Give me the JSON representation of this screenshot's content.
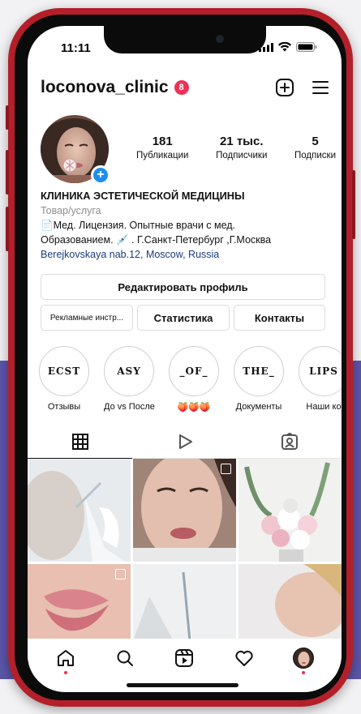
{
  "status_bar": {
    "time": "11:11"
  },
  "header": {
    "username": "loconova_clinic",
    "notification_count": "8"
  },
  "stats": [
    {
      "value": "181",
      "label": "Публикации"
    },
    {
      "value": "21 тыс.",
      "label": "Подписчики"
    },
    {
      "value": "5",
      "label": "Подписки"
    }
  ],
  "bio": {
    "title": "КЛИНИКА ЭСТЕТИЧЕСКОЙ МЕДИЦИНЫ",
    "category": "Товар/услуга",
    "line1": "📄Мед. Лицензия. Опытные врачи с мед.",
    "line2": "Образованием. 💉 . Г.Санкт-Петербург ,Г.Москва",
    "address": "Berejkovskaya nab.12, Moscow, Russia"
  },
  "buttons": {
    "edit_profile": "Редактировать профиль",
    "ads_tools": "Рекламные инстр...",
    "statistics": "Статистика",
    "contacts": "Контакты"
  },
  "highlights": [
    {
      "cover": "ECST",
      "label": "Отзывы"
    },
    {
      "cover": "ASY",
      "label": "До vs После"
    },
    {
      "cover": "_OF_",
      "label": "🍑🍑🍑"
    },
    {
      "cover": "THE_",
      "label": "Документы"
    },
    {
      "cover": "LIPS",
      "label": "Наши ко"
    }
  ],
  "tabs": [
    {
      "icon": "grid-icon",
      "active": true
    },
    {
      "icon": "reels-play-icon",
      "active": false
    },
    {
      "icon": "tagged-person-icon",
      "active": false
    }
  ],
  "bottom_nav": [
    {
      "icon": "home-icon",
      "notification_dot": true
    },
    {
      "icon": "search-icon",
      "notification_dot": false
    },
    {
      "icon": "reels-icon",
      "notification_dot": false
    },
    {
      "icon": "heart-icon",
      "notification_dot": false
    },
    {
      "icon": "profile-avatar-icon",
      "notification_dot": true
    }
  ],
  "colors": {
    "phone_frame": "#b3202a",
    "badge": "#ed3257",
    "plus_button": "#1c8ef0",
    "link": "#1a3d7c",
    "background_band": "#5b55a8"
  }
}
